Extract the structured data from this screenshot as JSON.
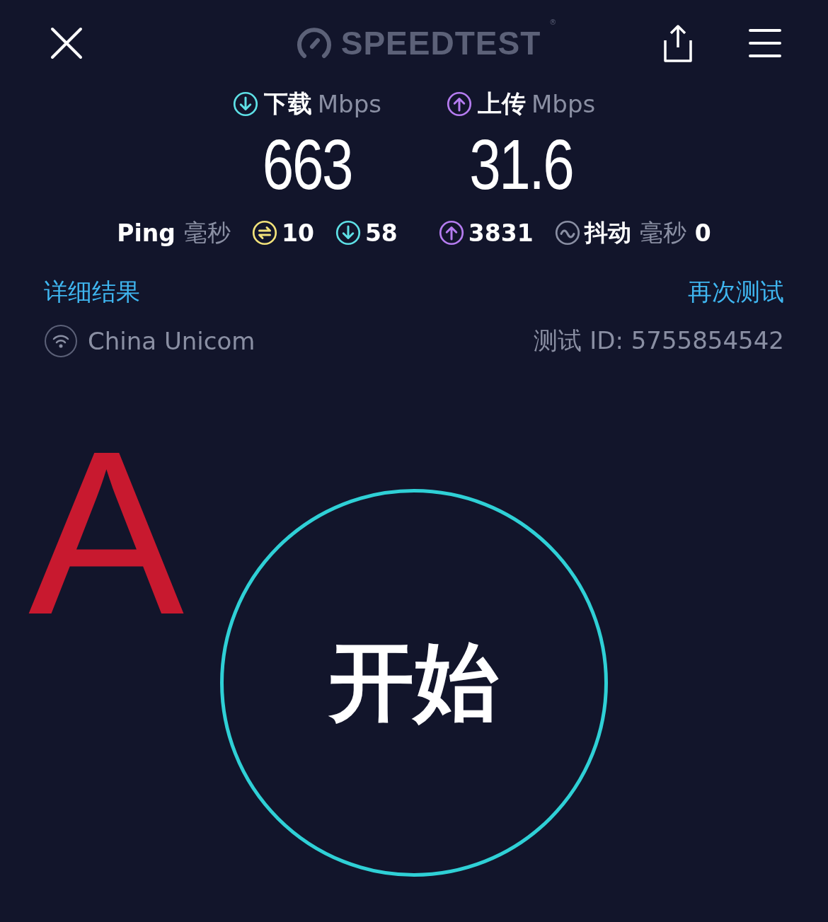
{
  "header": {
    "logo": "SPEEDTEST",
    "registered": "®"
  },
  "speeds": [
    {
      "kind": "download",
      "label": "下载",
      "unit": "Mbps",
      "value": "663"
    },
    {
      "kind": "upload",
      "label": "上传",
      "unit": "Mbps",
      "value": "31.6"
    }
  ],
  "ping": {
    "label": "Ping",
    "unit": "毫秒",
    "metrics": [
      {
        "kind": "idle",
        "value": "10"
      },
      {
        "kind": "download",
        "value": "58"
      },
      {
        "kind": "upload",
        "value": "3831"
      }
    ],
    "jitter": {
      "label": "抖动",
      "unit": "毫秒",
      "value": "0"
    }
  },
  "links": {
    "results": "详细结果",
    "retest": "再次测试"
  },
  "provider": "China Unicom",
  "test_id": "测试 ID: 5755854542",
  "annotation": "A",
  "start_button": "开始"
}
